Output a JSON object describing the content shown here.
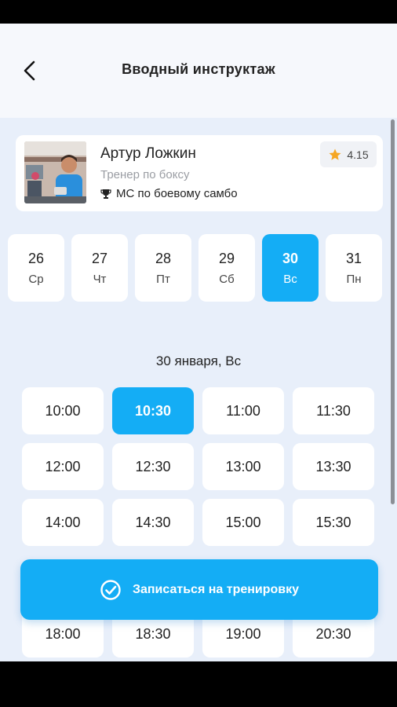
{
  "header": {
    "title": "Вводный инструктаж"
  },
  "trainer": {
    "name": "Артур Ложкин",
    "role": "Тренер по боксу",
    "award": "МС по боевому самбо",
    "rating": "4.15"
  },
  "days": [
    {
      "num": "26",
      "wd": "Ср"
    },
    {
      "num": "27",
      "wd": "Чт"
    },
    {
      "num": "28",
      "wd": "Пт"
    },
    {
      "num": "29",
      "wd": "Сб"
    },
    {
      "num": "30",
      "wd": "Вс"
    },
    {
      "num": "31",
      "wd": "Пн"
    }
  ],
  "selected_day_index": 4,
  "date_heading": "30 января, Вс",
  "slots": [
    "10:00",
    "10:30",
    "11:00",
    "11:30",
    "12:00",
    "12:30",
    "13:00",
    "13:30",
    "14:00",
    "14:30",
    "15:00",
    "15:30",
    "18:00",
    "18:30",
    "19:00",
    "20:30"
  ],
  "selected_slot": "10:30",
  "cta": {
    "label": "Записаться на тренировку"
  },
  "colors": {
    "accent": "#14adf5",
    "star": "#f5a623",
    "background": "#e8effa"
  }
}
